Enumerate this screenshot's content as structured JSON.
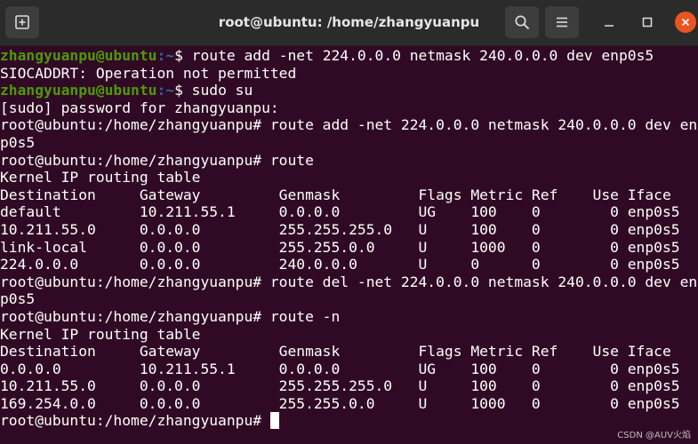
{
  "window": {
    "title": "root@ubuntu: /home/zhangyuanpu",
    "buttons": {
      "new_tab_icon": "new-tab-icon",
      "search_icon": "search-icon",
      "menu_icon": "hamburger-menu-icon",
      "minimize_icon": "minimize-icon",
      "maximize_icon": "maximize-icon",
      "close_icon": "close-icon"
    }
  },
  "colors": {
    "background": "#300a24",
    "titlebar": "#2b2b2b",
    "prompt_user": "#4e9a06",
    "prompt_path": "#3465a4",
    "close_button": "#e95420"
  },
  "terminal": {
    "lines": [
      {
        "prompt_user": "zhangyuanpu@ubuntu",
        "prompt_path": ":~",
        "prompt_end": "$ ",
        "text": "route add -net 224.0.0.0 netmask 240.0.0.0 dev enp0s5"
      },
      {
        "text": "SIOCADDRT: Operation not permitted"
      },
      {
        "prompt_user": "zhangyuanpu@ubuntu",
        "prompt_path": ":~",
        "prompt_end": "$ ",
        "text": "sudo su"
      },
      {
        "text": "[sudo] password for zhangyuanpu:"
      },
      {
        "text": "root@ubuntu:/home/zhangyuanpu# route add -net 224.0.0.0 netmask 240.0.0.0 dev en"
      },
      {
        "text": "p0s5"
      },
      {
        "text": "root@ubuntu:/home/zhangyuanpu# route"
      },
      {
        "text": "Kernel IP routing table"
      },
      {
        "text": "Destination     Gateway         Genmask         Flags Metric Ref    Use Iface"
      },
      {
        "text": "default         10.211.55.1     0.0.0.0         UG    100    0        0 enp0s5"
      },
      {
        "text": "10.211.55.0     0.0.0.0         255.255.255.0   U     100    0        0 enp0s5"
      },
      {
        "text": "link-local      0.0.0.0         255.255.0.0     U     1000   0        0 enp0s5"
      },
      {
        "text": "224.0.0.0       0.0.0.0         240.0.0.0       U     0      0        0 enp0s5"
      },
      {
        "text": "root@ubuntu:/home/zhangyuanpu# route del -net 224.0.0.0 netmask 240.0.0.0 dev en"
      },
      {
        "text": "p0s5"
      },
      {
        "text": "root@ubuntu:/home/zhangyuanpu# route -n"
      },
      {
        "text": "Kernel IP routing table"
      },
      {
        "text": "Destination     Gateway         Genmask         Flags Metric Ref    Use Iface"
      },
      {
        "text": "0.0.0.0         10.211.55.1     0.0.0.0         UG    100    0        0 enp0s5"
      },
      {
        "text": "10.211.55.0     0.0.0.0         255.255.255.0   U     100    0        0 enp0s5"
      },
      {
        "text": "169.254.0.0     0.0.0.0         255.255.0.0     U     1000   0        0 enp0s5"
      },
      {
        "text": "root@ubuntu:/home/zhangyuanpu# ",
        "cursor": true
      }
    ]
  },
  "watermark": "CSDN @AUV火焰"
}
